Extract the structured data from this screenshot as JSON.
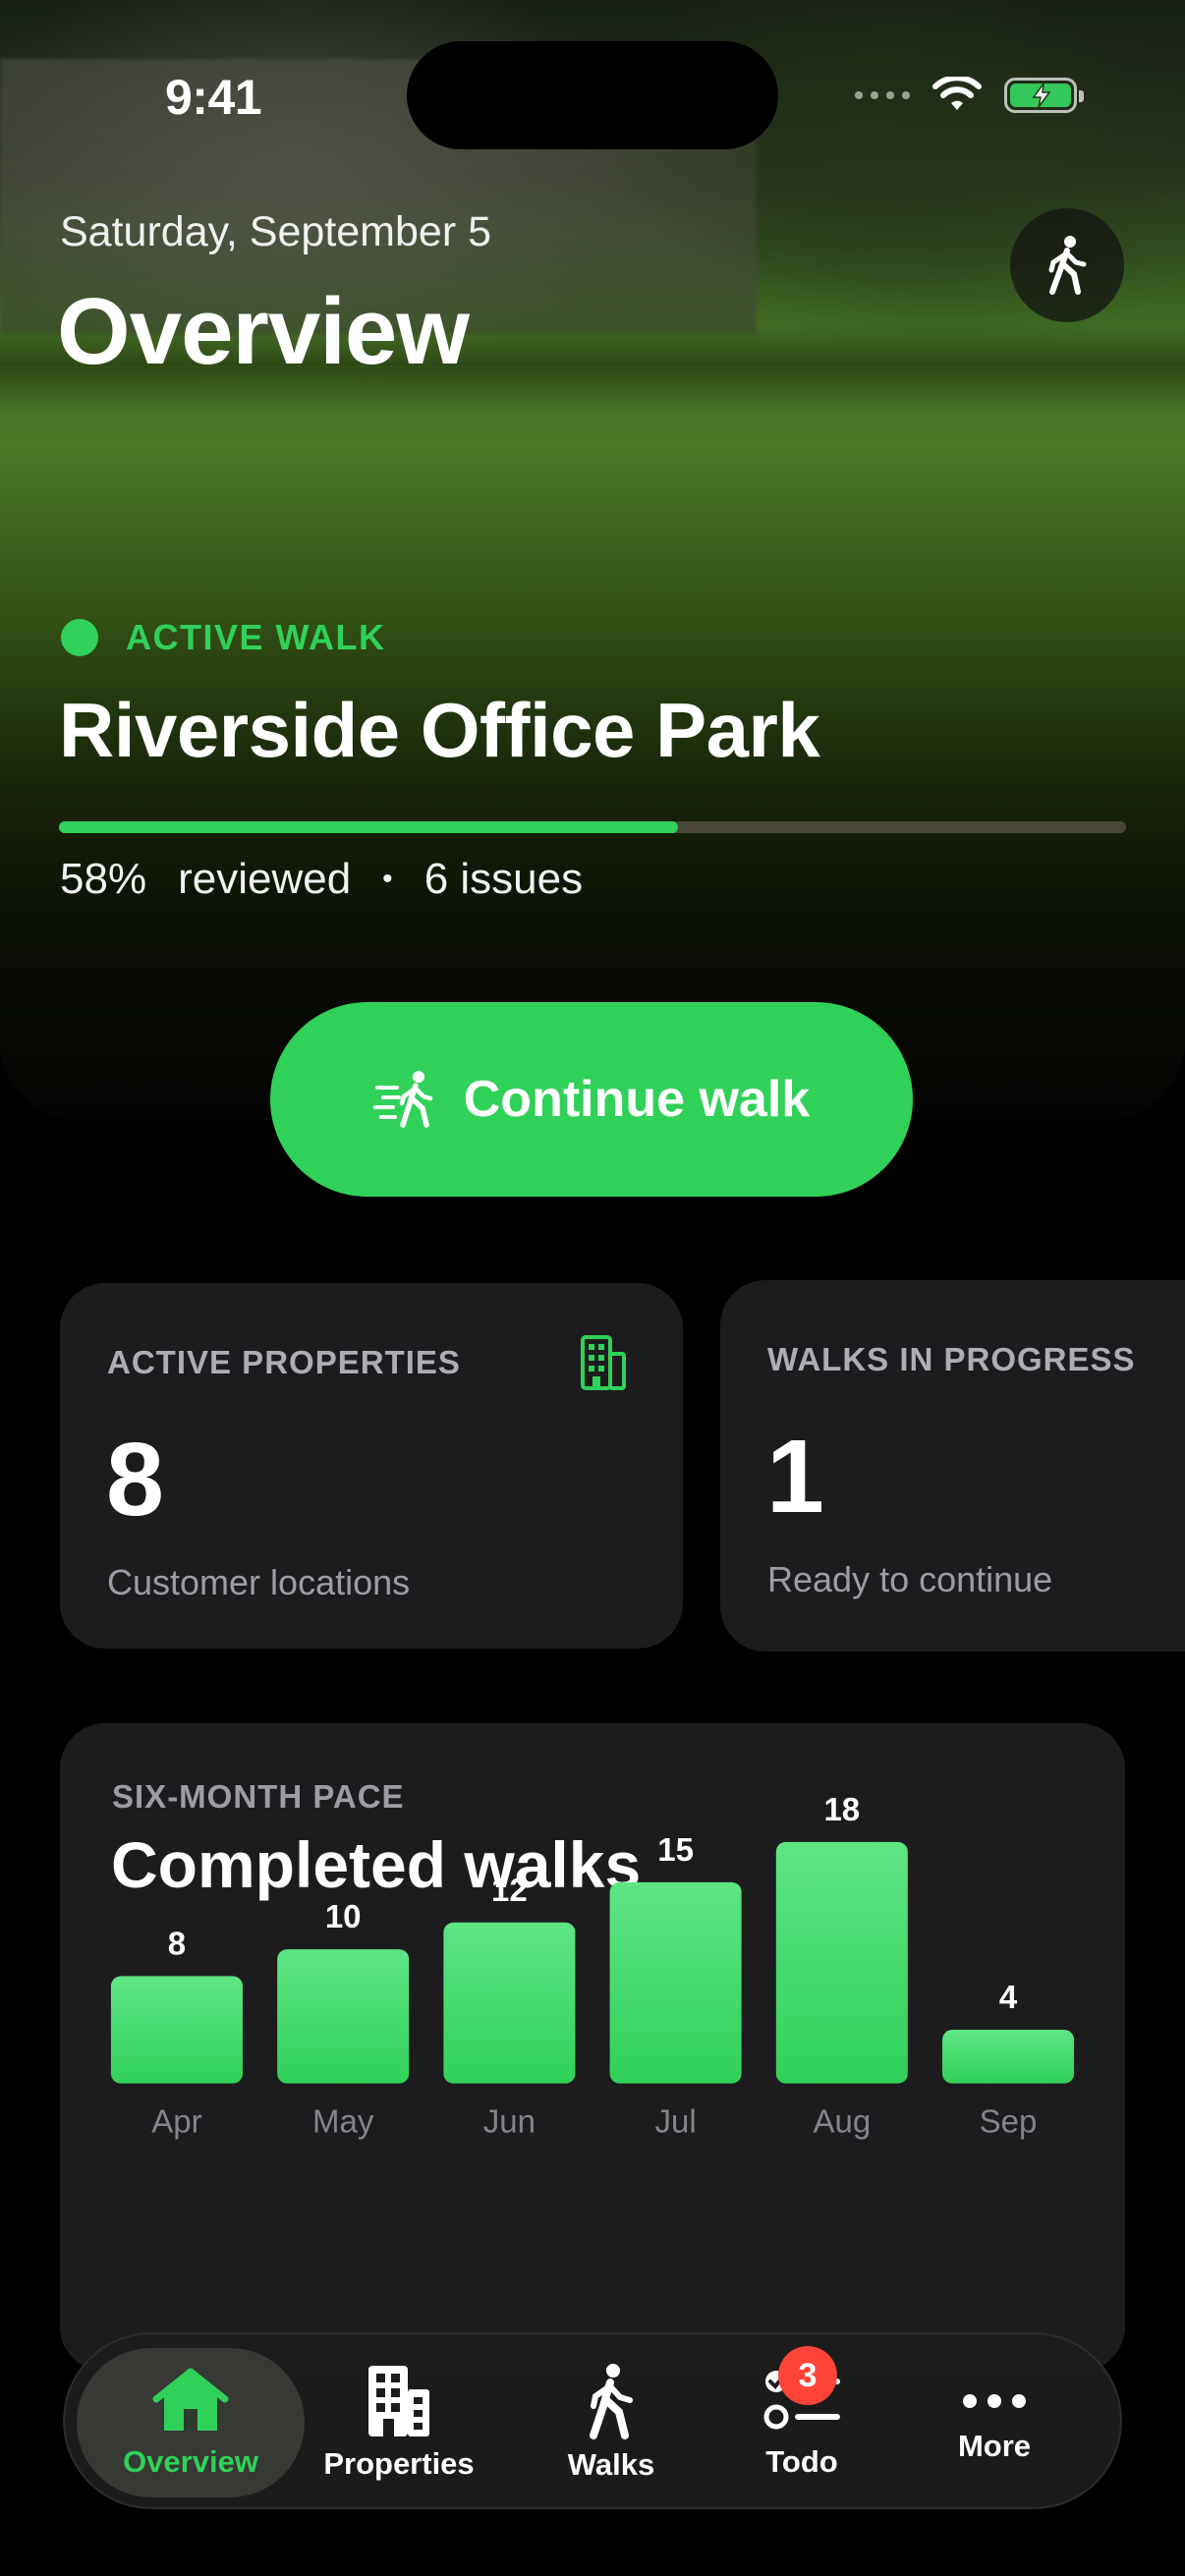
{
  "status_bar": {
    "time": "9:41"
  },
  "header": {
    "date": "Saturday, September 5",
    "title": "Overview",
    "walk_icon": "figure-walk-icon"
  },
  "active_walk": {
    "label": "ACTIVE WALK",
    "property": "Riverside Office Park",
    "progress": 0.58,
    "percent": "58%",
    "reviewed_label": "reviewed",
    "separator": "•",
    "issues": "6 issues",
    "button_label": "Continue walk"
  },
  "stats": [
    {
      "label": "ACTIVE PROPERTIES",
      "value": "8",
      "sub": "Customer locations",
      "icon": "building-icon"
    },
    {
      "label": "WALKS IN PROGRESS",
      "value": "1",
      "sub": "Ready to continue"
    }
  ],
  "chart_card": {
    "kicker": "SIX-MONTH PACE",
    "title": "Completed walks"
  },
  "chart_data": {
    "type": "bar",
    "categories": [
      "Apr",
      "May",
      "Jun",
      "Jul",
      "Aug",
      "Sep"
    ],
    "values": [
      8,
      10,
      12,
      15,
      18,
      4
    ],
    "title": "Completed walks",
    "xlabel": "",
    "ylabel": "",
    "ylim": [
      0,
      18
    ],
    "grid": false,
    "color": "#30d158"
  },
  "tabbar": {
    "items": [
      {
        "label": "Overview",
        "icon": "house-icon",
        "active": true
      },
      {
        "label": "Properties",
        "icon": "building-icon",
        "active": false
      },
      {
        "label": "Walks",
        "icon": "figure-walk-icon",
        "active": false
      },
      {
        "label": "Todo",
        "icon": "checklist-icon",
        "active": false,
        "badge": "3"
      },
      {
        "label": "More",
        "icon": "ellipsis-icon",
        "active": false
      }
    ]
  },
  "colors": {
    "accent": "#30d158",
    "card": "#1c1c1e",
    "badge": "#ff453a"
  }
}
